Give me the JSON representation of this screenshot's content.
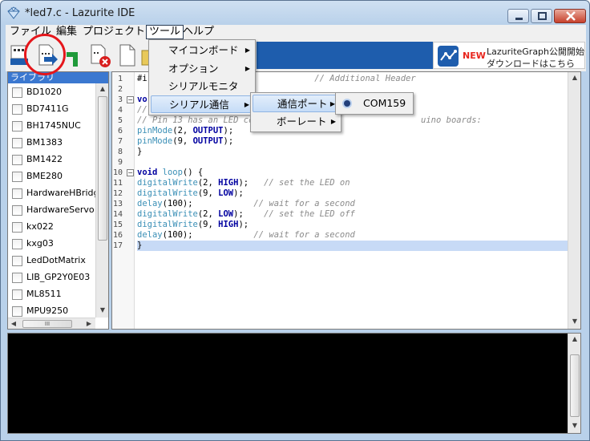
{
  "window": {
    "title": "*led7.c - Lazurite IDE"
  },
  "menubar": [
    "ファイル",
    "編集",
    "プロジェクト",
    "ツール",
    "ヘルプ"
  ],
  "toolbar": {
    "ad_new": "NEW",
    "ad_line1": "LazuriteGraph公開開始",
    "ad_line2": "ダウンロードはこちら"
  },
  "library": {
    "header": "ライブラリ",
    "items": [
      "BD1020",
      "BD7411G",
      "BH1745NUC",
      "BM1383",
      "BM1422",
      "BME280",
      "HardwareHBridge",
      "HardwareServo",
      "kx022",
      "kxg03",
      "LedDotMatrix",
      "LIB_GP2Y0E03",
      "ML8511",
      "MPU9250"
    ],
    "hscroll_grip": "III"
  },
  "editor": {
    "lines": [
      {
        "n": "1",
        "segments": [
          {
            "t": "#i",
            "c": "pl"
          },
          {
            "t": "                                 // Additional Header",
            "c": "cm"
          }
        ]
      },
      {
        "n": "2",
        "segments": []
      },
      {
        "n": "3",
        "segments": [
          {
            "t": "vo",
            "c": "kw"
          }
        ]
      },
      {
        "n": "4",
        "segments": [
          {
            "t": "//",
            "c": "cm"
          }
        ]
      },
      {
        "n": "5",
        "segments": [
          {
            "t": "// Pin 13 has an LED co",
            "c": "cm"
          },
          {
            "t": "                                 uino boards:",
            "c": "cm"
          }
        ]
      },
      {
        "n": "6",
        "segments": [
          {
            "t": "pinMode",
            "c": "fn"
          },
          {
            "t": "(2, ",
            "c": "pl"
          },
          {
            "t": "OUTPUT",
            "c": "kw"
          },
          {
            "t": ");",
            "c": "pl"
          }
        ]
      },
      {
        "n": "7",
        "segments": [
          {
            "t": "pinMode",
            "c": "fn"
          },
          {
            "t": "(9, ",
            "c": "pl"
          },
          {
            "t": "OUTPUT",
            "c": "kw"
          },
          {
            "t": ");",
            "c": "pl"
          }
        ]
      },
      {
        "n": "8",
        "segments": [
          {
            "t": "}",
            "c": "pl"
          }
        ]
      },
      {
        "n": "9",
        "segments": []
      },
      {
        "n": "10",
        "segments": [
          {
            "t": "void",
            "c": "kw"
          },
          {
            "t": " ",
            "c": "pl"
          },
          {
            "t": "loop",
            "c": "fn"
          },
          {
            "t": "() {",
            "c": "pl"
          }
        ]
      },
      {
        "n": "11",
        "segments": [
          {
            "t": "digitalWrite",
            "c": "fn"
          },
          {
            "t": "(2, ",
            "c": "pl"
          },
          {
            "t": "HIGH",
            "c": "kw"
          },
          {
            "t": ");   ",
            "c": "pl"
          },
          {
            "t": "// set the LED on",
            "c": "cm"
          }
        ]
      },
      {
        "n": "12",
        "segments": [
          {
            "t": "digitalWrite",
            "c": "fn"
          },
          {
            "t": "(9, ",
            "c": "pl"
          },
          {
            "t": "LOW",
            "c": "kw"
          },
          {
            "t": ");",
            "c": "pl"
          }
        ]
      },
      {
        "n": "13",
        "segments": [
          {
            "t": "delay",
            "c": "fn"
          },
          {
            "t": "(100);            ",
            "c": "pl"
          },
          {
            "t": "// wait for a second",
            "c": "cm"
          }
        ]
      },
      {
        "n": "14",
        "segments": [
          {
            "t": "digitalWrite",
            "c": "fn"
          },
          {
            "t": "(2, ",
            "c": "pl"
          },
          {
            "t": "LOW",
            "c": "kw"
          },
          {
            "t": ");    ",
            "c": "pl"
          },
          {
            "t": "// set the LED off",
            "c": "cm"
          }
        ]
      },
      {
        "n": "15",
        "segments": [
          {
            "t": "digitalWrite",
            "c": "fn"
          },
          {
            "t": "(9, ",
            "c": "pl"
          },
          {
            "t": "HIGH",
            "c": "kw"
          },
          {
            "t": ");",
            "c": "pl"
          }
        ]
      },
      {
        "n": "16",
        "segments": [
          {
            "t": "delay",
            "c": "fn"
          },
          {
            "t": "(100);            ",
            "c": "pl"
          },
          {
            "t": "// wait for a second",
            "c": "cm"
          }
        ]
      },
      {
        "n": "17",
        "segments": [
          {
            "t": "}",
            "c": "pl"
          }
        ]
      }
    ],
    "highlight_line": "17"
  },
  "tools_menu": {
    "items": [
      "マイコンボード",
      "オプション",
      "シリアルモニタ",
      "シリアル通信"
    ],
    "selected": "シリアル通信"
  },
  "serial_menu": {
    "items": [
      "通信ポート",
      "ボーレート"
    ],
    "selected": "通信ポート"
  },
  "port_menu": {
    "items": [
      "COM159"
    ],
    "checked": "COM159"
  },
  "colors": {
    "accent": "#3b78d0",
    "highlight": "#c7daf6",
    "annotation": "#e5161b",
    "keyword": "#0000a0",
    "function": "#3a8fb6",
    "comment": "#8a8a8a"
  }
}
